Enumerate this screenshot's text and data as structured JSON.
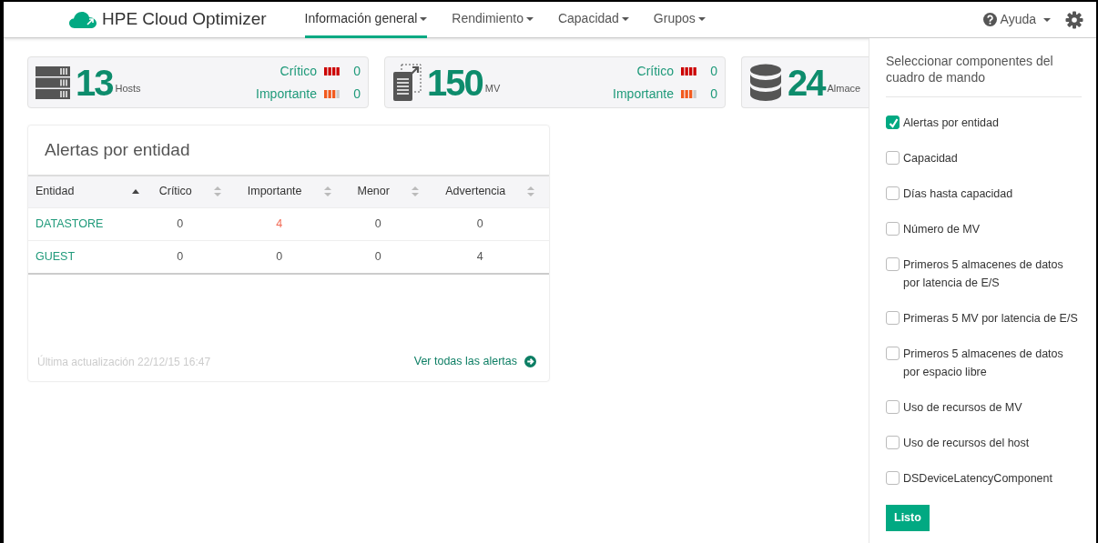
{
  "navbar": {
    "brand": "HPE Cloud Optimizer",
    "menus": [
      {
        "label": "Información general",
        "selected": true
      },
      {
        "label": "Rendimiento",
        "selected": false
      },
      {
        "label": "Capacidad",
        "selected": false
      },
      {
        "label": "Grupos",
        "selected": false
      }
    ],
    "help": "Ayuda"
  },
  "summary_cards": [
    {
      "kind": "hosts",
      "count": "13",
      "unit": "Hosts",
      "severities": [
        {
          "kind": "critical",
          "label": "Crítico",
          "count": "0"
        },
        {
          "kind": "major",
          "label": "Importante",
          "count": "0"
        }
      ]
    },
    {
      "kind": "vms",
      "count": "150",
      "unit": "MV",
      "severities": [
        {
          "kind": "critical",
          "label": "Crítico",
          "count": "0"
        },
        {
          "kind": "major",
          "label": "Importante",
          "count": "0"
        }
      ]
    },
    {
      "kind": "datastores",
      "count": "24",
      "unit": "Almace"
    }
  ],
  "alerts_panel": {
    "title": "Alertas por entidad",
    "columns": [
      {
        "label": "Entidad",
        "sorted": true
      },
      {
        "label": "Crítico",
        "sorted": false
      },
      {
        "label": "Importante",
        "sorted": false
      },
      {
        "label": "Menor",
        "sorted": false
      },
      {
        "label": "Advertencia",
        "sorted": false
      }
    ],
    "rows": [
      {
        "cells": [
          {
            "text": "DATASTORE",
            "highlight": false
          },
          {
            "text": "0",
            "highlight": false
          },
          {
            "text": "4",
            "highlight": true
          },
          {
            "text": "0",
            "highlight": false
          },
          {
            "text": "0",
            "highlight": false
          }
        ]
      },
      {
        "cells": [
          {
            "text": "GUEST",
            "highlight": false
          },
          {
            "text": "0",
            "highlight": false
          },
          {
            "text": "0",
            "highlight": false
          },
          {
            "text": "0",
            "highlight": false
          },
          {
            "text": "4",
            "highlight": false
          }
        ]
      }
    ],
    "last_update": "Última actualización 22/12/15 16:47",
    "link": "Ver todas las alertas"
  },
  "side_panel": {
    "title": "Seleccionar componentes del cuadro de mando",
    "components": [
      {
        "label": "Alertas por entidad",
        "checked": true
      },
      {
        "label": "Capacidad",
        "checked": false
      },
      {
        "label": "Días hasta capacidad",
        "checked": false
      },
      {
        "label": "Número de MV",
        "checked": false
      },
      {
        "label": "Primeros 5 almacenes de datos por latencia de E/S",
        "checked": false
      },
      {
        "label": "Primeras 5 MV por latencia de E/S",
        "checked": false
      },
      {
        "label": "Primeros 5 almacenes de datos por espacio libre",
        "checked": false
      },
      {
        "label": "Uso de recursos de MV",
        "checked": false
      },
      {
        "label": "Uso de recursos del host",
        "checked": false
      },
      {
        "label": "DSDeviceLatencyComponent",
        "checked": false
      }
    ],
    "button": "Listo"
  }
}
